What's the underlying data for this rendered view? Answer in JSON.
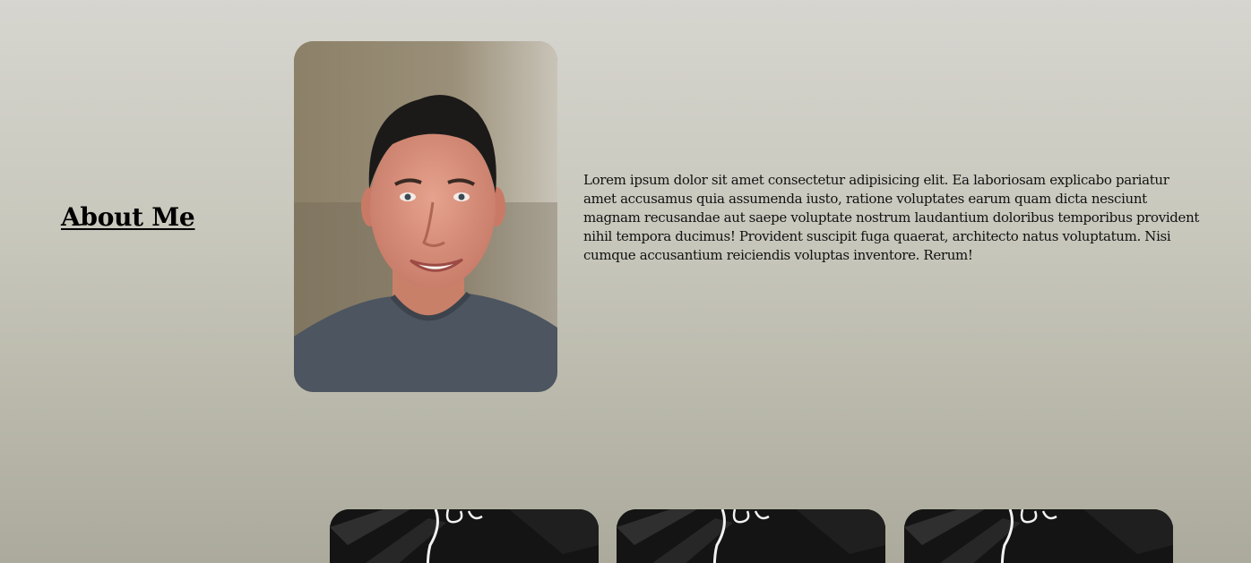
{
  "about": {
    "heading": "About Me",
    "portrait_icon": "portrait-photo",
    "bio": "Lorem ipsum dolor sit amet consectetur adipisicing elit. Ea laboriosam explicabo pariatur amet accusamus quia assumenda iusto, ratione voluptates earum quam dicta nesciunt magnam recusandae aut saepe voluptate nostrum laudantium doloribus temporibus provident nihil tempora ducimus! Provident suscipit fuga quaerat, architecto natus voluptatum. Nisi cumque accusantium reiciendis voluptas inventore. Rerum!"
  },
  "projects": {
    "cards": [
      {
        "image": "dark-neon-script-thumbnail"
      },
      {
        "image": "dark-neon-script-thumbnail"
      },
      {
        "image": "dark-neon-script-thumbnail"
      }
    ]
  },
  "colors": {
    "background_top": "#d6d5cf",
    "background_bottom": "#abaa9c",
    "text": "#000000",
    "card_background": "#121212"
  }
}
